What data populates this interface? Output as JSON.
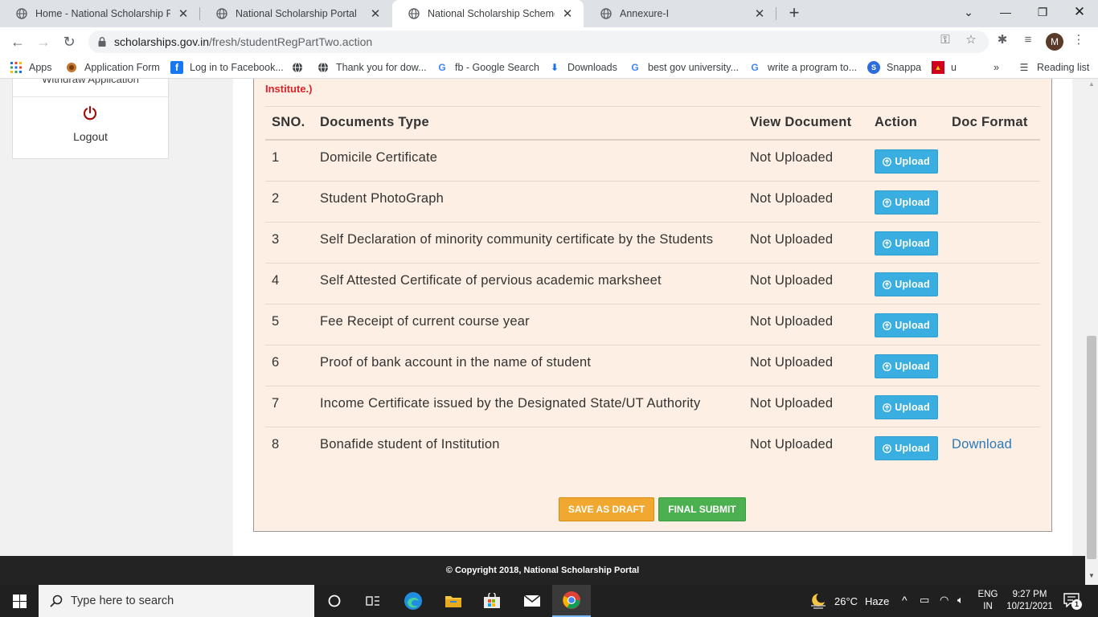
{
  "browser": {
    "tabs": [
      {
        "title": "Home - National Scholarship Por",
        "active": false
      },
      {
        "title": "National Scholarship Portal",
        "active": false
      },
      {
        "title": "National Scholarship Scheme",
        "active": true
      },
      {
        "title": "Annexure-I",
        "active": false
      }
    ],
    "new_tab_label": "+",
    "url_host": "scholarships.gov.in",
    "url_path": "/fresh/studentRegPartTwo.action",
    "profile_initial": "M",
    "bookmarks": [
      {
        "label": "Apps",
        "icon": "apps-grid-icon"
      },
      {
        "label": "Application Form",
        "icon": "emblem-icon"
      },
      {
        "label": "Log in to Facebook...",
        "icon": "facebook-icon"
      },
      {
        "label": "",
        "icon": "globe-icon"
      },
      {
        "label": "Thank you for dow...",
        "icon": "globe-icon"
      },
      {
        "label": "fb - Google Search",
        "icon": "google-icon"
      },
      {
        "label": "Downloads",
        "icon": "download-icon"
      },
      {
        "label": "best gov university...",
        "icon": "google-icon"
      },
      {
        "label": "write a program to...",
        "icon": "google-icon"
      },
      {
        "label": "Snappa",
        "icon": "snappa-icon"
      },
      {
        "label": "u",
        "icon": "bookmark-red-icon"
      }
    ],
    "bookmarks_overflow": "»",
    "reading_list": "Reading list"
  },
  "sidebar": {
    "previous_item": "Withdraw Application",
    "logout_label": "Logout"
  },
  "main": {
    "notice_text": "Institute.)",
    "table": {
      "headers": [
        "SNO.",
        "Documents Type",
        "View Document",
        "Action",
        "Doc Format"
      ],
      "rows": [
        {
          "sno": "1",
          "type": "Domicile Certificate",
          "view": "Not Uploaded",
          "action": "Upload",
          "format": ""
        },
        {
          "sno": "2",
          "type": "Student PhotoGraph",
          "view": "Not Uploaded",
          "action": "Upload",
          "format": ""
        },
        {
          "sno": "3",
          "type": "Self Declaration of minority community certificate by the Students",
          "view": "Not Uploaded",
          "action": "Upload",
          "format": ""
        },
        {
          "sno": "4",
          "type": "Self Attested Certificate of pervious academic marksheet",
          "view": "Not Uploaded",
          "action": "Upload",
          "format": ""
        },
        {
          "sno": "5",
          "type": "Fee Receipt of current course year",
          "view": "Not Uploaded",
          "action": "Upload",
          "format": ""
        },
        {
          "sno": "6",
          "type": "Proof of bank account in the name of student",
          "view": "Not Uploaded",
          "action": "Upload",
          "format": ""
        },
        {
          "sno": "7",
          "type": "Income Certificate issued by the Designated State/UT Authority",
          "view": "Not Uploaded",
          "action": "Upload",
          "format": ""
        },
        {
          "sno": "8",
          "type": "Bonafide student of Institution",
          "view": "Not Uploaded",
          "action": "Upload",
          "format": "Download"
        }
      ]
    },
    "save_draft_label": "SAVE AS DRAFT",
    "final_submit_label": "FINAL SUBMIT"
  },
  "footer": {
    "copyright": "© Copyright 2018, National Scholarship Portal"
  },
  "taskbar": {
    "search_placeholder": "Type here to search",
    "weather_temp": "26°C",
    "weather_desc": "Haze",
    "lang_top": "ENG",
    "lang_bottom": "IN",
    "time": "9:27 PM",
    "date": "10/21/2021",
    "notification_count": "1"
  },
  "colors": {
    "panel_bg": "#fdefe3",
    "notice_red": "#d9232d",
    "upload_blue": "#3aaee0",
    "draft_orange": "#f0a830",
    "submit_green": "#4caf50",
    "logout_red": "#a01010"
  }
}
